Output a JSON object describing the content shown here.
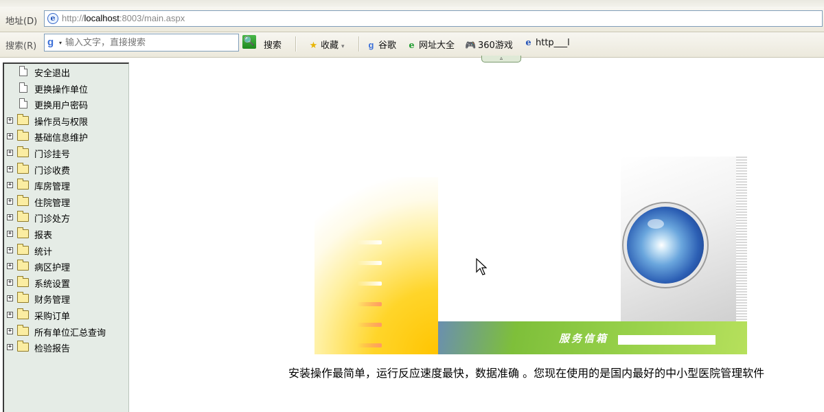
{
  "address_bar": {
    "label": "地址(D)",
    "url_prefix": "http://",
    "url_host": "localhost",
    "url_rest": ":8003/main.aspx"
  },
  "search_bar": {
    "label": "搜索(R)",
    "placeholder": "输入文字，直接搜索",
    "search_button": "搜索",
    "links": [
      {
        "label": "收藏",
        "icon": "star-icon"
      },
      {
        "label": "谷歌",
        "icon": "google-icon"
      },
      {
        "label": "网址大全",
        "icon": "ie-green-icon"
      },
      {
        "label": "360游戏",
        "icon": "gamepad-icon"
      },
      {
        "label": "http___l",
        "icon": "ie-page-icon"
      }
    ]
  },
  "sidebar": {
    "items": [
      {
        "label": "安全退出",
        "type": "doc"
      },
      {
        "label": "更换操作单位",
        "type": "doc"
      },
      {
        "label": "更换用户密码",
        "type": "doc"
      },
      {
        "label": "操作员与权限",
        "type": "folder"
      },
      {
        "label": "基础信息维护",
        "type": "folder"
      },
      {
        "label": "门诊挂号",
        "type": "folder"
      },
      {
        "label": "门诊收费",
        "type": "folder"
      },
      {
        "label": "库房管理",
        "type": "folder"
      },
      {
        "label": "住院管理",
        "type": "folder"
      },
      {
        "label": "门诊处方",
        "type": "folder"
      },
      {
        "label": "报表",
        "type": "folder"
      },
      {
        "label": "统计",
        "type": "folder"
      },
      {
        "label": "病区护理",
        "type": "folder"
      },
      {
        "label": "系统设置",
        "type": "folder"
      },
      {
        "label": "财务管理",
        "type": "folder"
      },
      {
        "label": "采购订单",
        "type": "folder"
      },
      {
        "label": "所有单位汇总查询",
        "type": "folder"
      },
      {
        "label": "检验报告",
        "type": "folder"
      }
    ]
  },
  "banner": {
    "service_label": "服务信箱"
  },
  "slogan": "安装操作最简单，运行反应速度最快，数据准确 。您现在使用的是国内最好的中小型医院管理软件"
}
